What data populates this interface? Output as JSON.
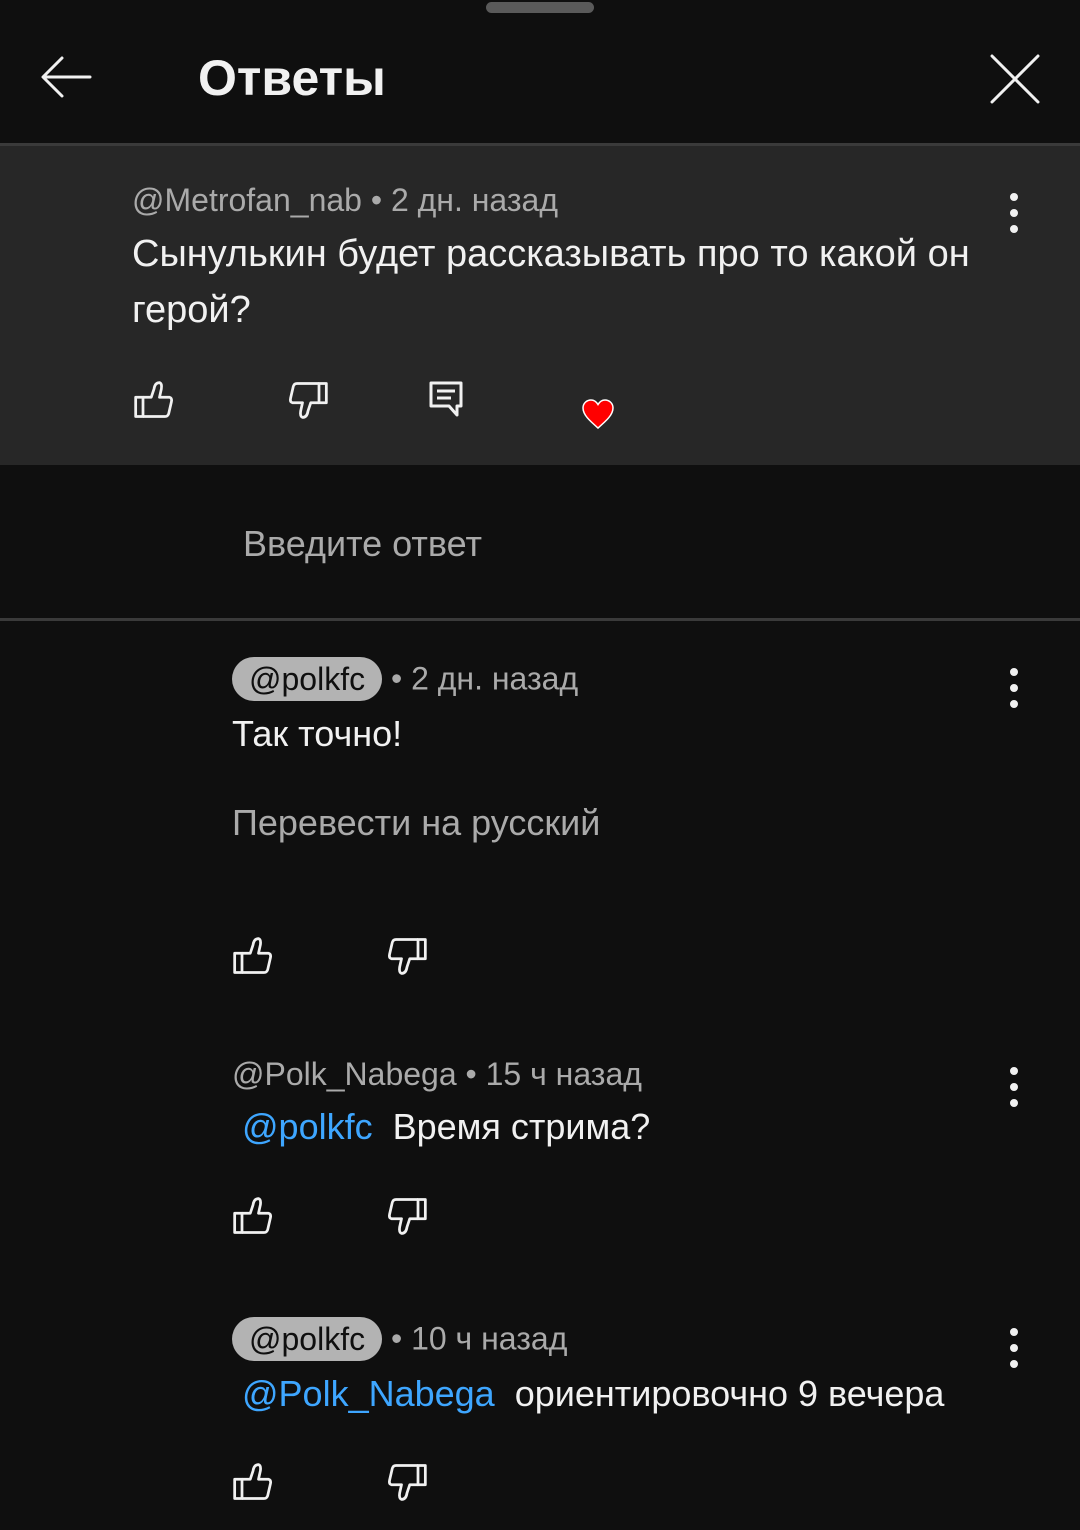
{
  "header": {
    "title": "Ответы"
  },
  "parent_comment": {
    "author": "@Metrofan_nab",
    "separator": " • ",
    "time": "2 дн. назад",
    "text": "Сынулькин будет рассказывать про то какой он герой?"
  },
  "reply_input": {
    "placeholder": "Введите ответ"
  },
  "replies": [
    {
      "author": "@polkfc",
      "separator": " • ",
      "time": "2 дн. назад",
      "text": "Так точно!",
      "translate_label": "Перевести на русский"
    },
    {
      "author": "@Polk_Nabega",
      "separator": " • ",
      "time": "15 ч назад",
      "mention": "@polkfc",
      "text": "Время стрима?"
    },
    {
      "author": "@polkfc",
      "separator": " • ",
      "time": "10 ч назад",
      "mention": "@Polk_Nabega",
      "text": "ориентировочно 9 вечера"
    }
  ],
  "icons": {
    "back": "arrow-left-icon",
    "close": "close-icon",
    "more": "more-vertical-icon",
    "like": "thumbs-up-icon",
    "dislike": "thumbs-down-icon",
    "reply": "comment-icon",
    "creator_heart": "heart-icon"
  },
  "colors": {
    "background": "#0f0f0f",
    "parent_background": "#272727",
    "mention": "#3ea6ff",
    "heart": "#ff0000",
    "secondary_text": "#aaaaaa",
    "author_chip": "#b3b3b3"
  }
}
